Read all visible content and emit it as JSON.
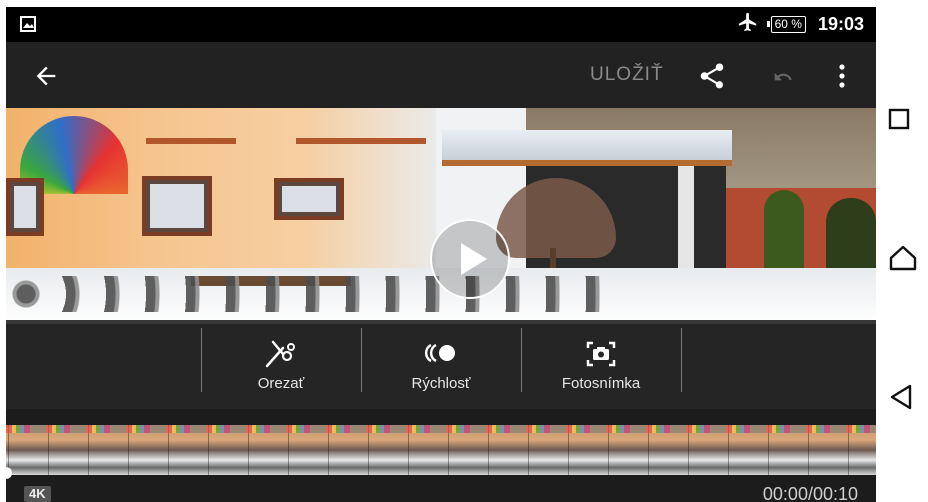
{
  "status_bar": {
    "notification_icon": "image-icon",
    "airplane_icon": "airplane-icon",
    "battery": "60 %",
    "time": "19:03"
  },
  "toolbar": {
    "back_icon": "arrow-left-icon",
    "save_label": "ULOŽIŤ",
    "share_icon": "share-icon",
    "undo_icon": "undo-icon",
    "more_icon": "more-vertical-icon"
  },
  "video": {
    "play_icon": "play-icon"
  },
  "tools": [
    {
      "icon": "scissors-icon",
      "label": "Orezať"
    },
    {
      "icon": "speed-icon",
      "label": "Rýchlosť"
    },
    {
      "icon": "camera-icon",
      "label": "Fotosnímka"
    }
  ],
  "timeline": {
    "quality_badge": "4K",
    "time_readout": "00:00/00:10",
    "progress": 0
  },
  "nav_bar": {
    "recents_icon": "square-icon",
    "home_icon": "home-icon",
    "back_icon": "triangle-back-icon"
  },
  "colors": {
    "toolbar_bg": "#222222",
    "save_disabled": "#8a8a8a",
    "panel_bg": "#282828"
  }
}
